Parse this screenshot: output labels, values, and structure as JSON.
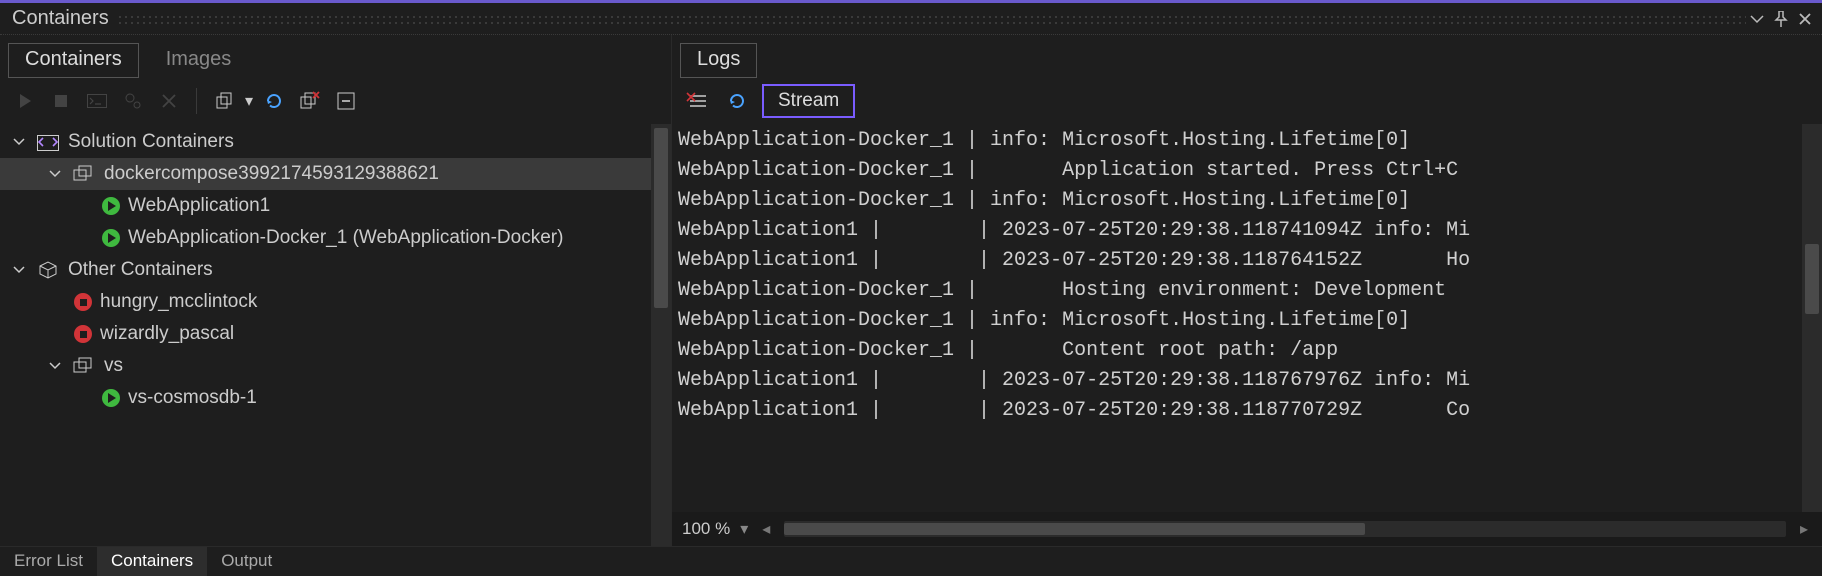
{
  "panel": {
    "title": "Containers"
  },
  "leftTabs": {
    "containers": "Containers",
    "images": "Images"
  },
  "tree": {
    "solution_label": "Solution Containers",
    "compose_label": "dockercompose3992174593129388621",
    "compose_items": [
      {
        "label": "WebApplication1",
        "status": "running"
      },
      {
        "label": "WebApplication-Docker_1 (WebApplication-Docker)",
        "status": "running"
      }
    ],
    "other_label": "Other Containers",
    "other_items": [
      {
        "label": "hungry_mcclintock",
        "status": "stopped"
      },
      {
        "label": "wizardly_pascal",
        "status": "stopped"
      }
    ],
    "vs_label": "vs",
    "vs_items": [
      {
        "label": "vs-cosmosdb-1",
        "status": "running"
      }
    ]
  },
  "rightTabs": {
    "logs": "Logs"
  },
  "rightToolbar": {
    "stream": "Stream"
  },
  "log_lines": [
    "WebApplication-Docker_1 | info: Microsoft.Hosting.Lifetime[0]",
    "WebApplication-Docker_1 |       Application started. Press Ctrl+C",
    "WebApplication-Docker_1 | info: Microsoft.Hosting.Lifetime[0]",
    "WebApplication1 |        | 2023-07-25T20:29:38.118741094Z info: Mi",
    "WebApplication1 |        | 2023-07-25T20:29:38.118764152Z       Ho",
    "WebApplication-Docker_1 |       Hosting environment: Development",
    "WebApplication-Docker_1 | info: Microsoft.Hosting.Lifetime[0]",
    "WebApplication-Docker_1 |       Content root path: /app",
    "WebApplication1 |        | 2023-07-25T20:29:38.118767976Z info: Mi",
    "WebApplication1 |        | 2023-07-25T20:29:38.118770729Z       Co"
  ],
  "zoom": "100 %",
  "footerTabs": {
    "error_list": "Error List",
    "containers": "Containers",
    "output": "Output"
  }
}
